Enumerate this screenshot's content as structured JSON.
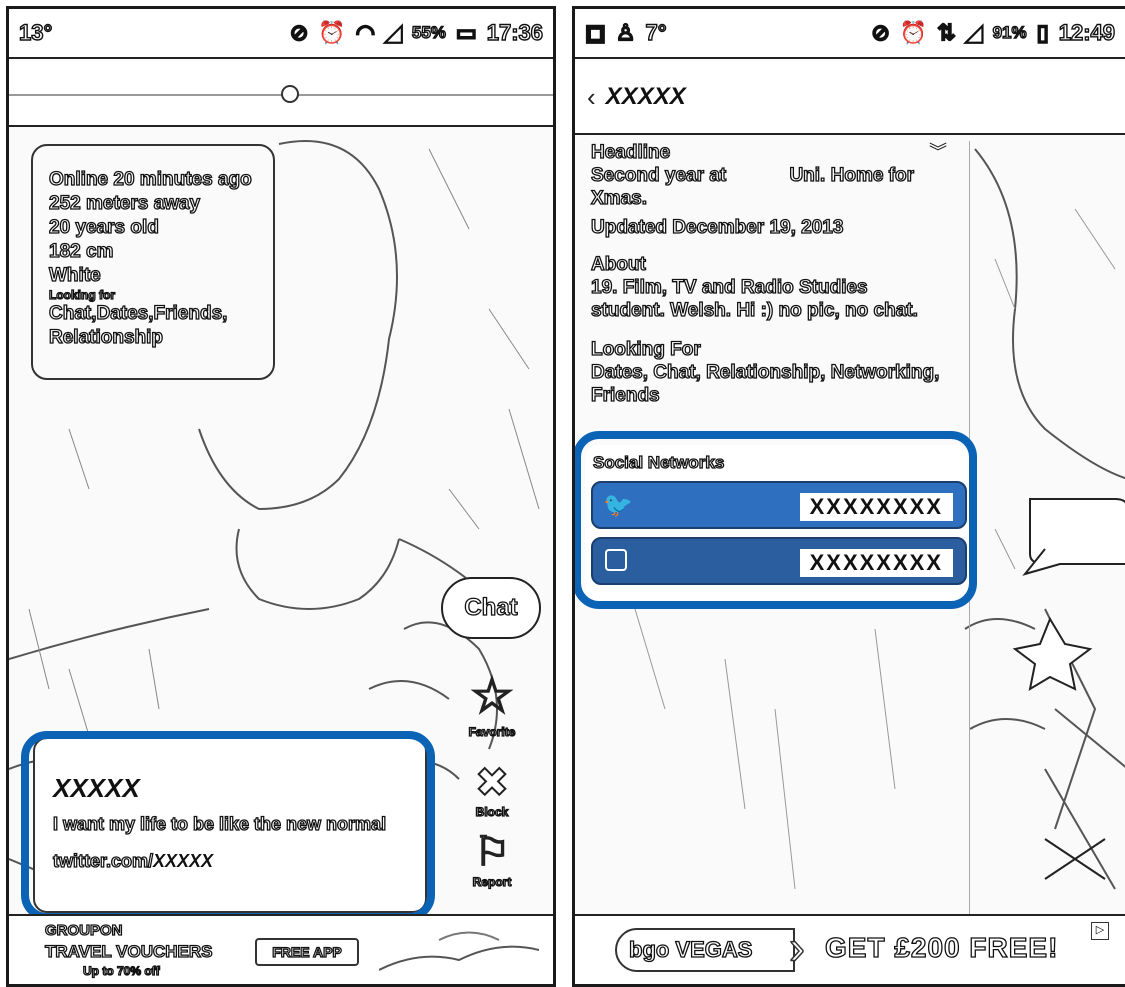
{
  "left_screen": {
    "status_bar": {
      "temperature": "13°",
      "battery": "55%",
      "time": "17:36"
    },
    "profile_info": {
      "online": "Online 20 minutes ago",
      "distance": "252 meters away",
      "age": "20 years old",
      "height": "182 cm",
      "ethnicity": "White",
      "looking_for_label": "Looking for",
      "looking_for_value": "Chat,Dates,Friends,",
      "looking_for_value2": "Relationship"
    },
    "chat_label": "Chat",
    "actions": {
      "favorite": "Favorite",
      "block": "Block",
      "report": "Report"
    },
    "profile_card": {
      "name": "XXXXX",
      "tagline": "I want my life to be like the new normal",
      "twitter_prefix": "twitter.com/",
      "twitter_handle": "XXXXX"
    },
    "ad": {
      "brand": "GROUPON",
      "line1": "TRAVEL VOUCHERS",
      "line2": "Up to 70% off",
      "cta": "FREE APP"
    }
  },
  "right_screen": {
    "status_bar": {
      "temperature": "7°",
      "battery": "91%",
      "time": "12:49"
    },
    "title_bar": {
      "back": "‹",
      "title": "XXXXX"
    },
    "headline_label": "Headline",
    "headline_text_a": "Second year at",
    "headline_text_b": "Uni. Home for",
    "headline_text_c": "Xmas.",
    "updated": "Updated December 19, 2013",
    "about_label": "About",
    "about_line1": "19. Film, TV and Radio Studies",
    "about_line2": "student. Welsh. Hi :) no pic, no chat.",
    "looking_for_label": "Looking For",
    "looking_for_line1": "Dates, Chat, Relationship, Networking,",
    "looking_for_line2": "Friends",
    "social_networks_label": "Social Networks",
    "social": [
      {
        "icon": "twitter-bird-icon",
        "value": "XXXXXXXX"
      },
      {
        "icon": "instagram-icon",
        "value": "XXXXXXXX"
      }
    ],
    "ad": {
      "brand": "bgo VEGAS",
      "cta": "GET £200 FREE!"
    }
  },
  "colors": {
    "highlight": "#0a63b5",
    "social_bar": "#2f6fbf",
    "line": "#111111"
  }
}
